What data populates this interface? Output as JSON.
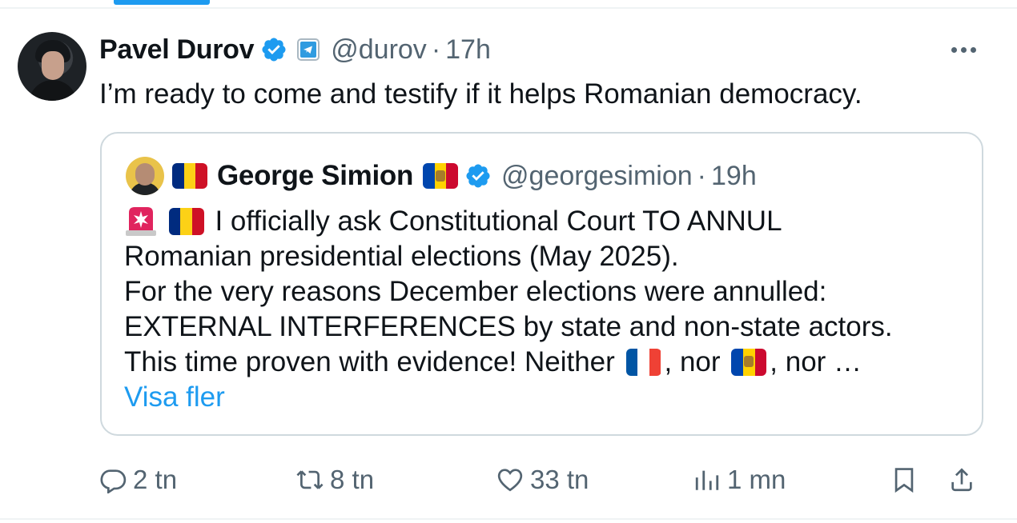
{
  "tweet": {
    "author_name": "Pavel Durov",
    "handle": "@durov",
    "separator": "·",
    "time": "17h",
    "text": "I’m ready to come and testify if it helps Romanian democracy.",
    "icons": {
      "verified": "verified-badge-icon",
      "telegram": "telegram-icon",
      "more": "more-options-icon"
    }
  },
  "quote": {
    "author_name": "George Simion",
    "handle": "@georgesimion",
    "separator": "·",
    "time": "19h",
    "lines": [
      "I officially ask Constitutional Court TO ANNUL",
      "Romanian presidential elections (May 2025).",
      "For the very reasons December elections were annulled:",
      "EXTERNAL INTERFERENCES by state and non-state actors.",
      "This time proven with evidence! Neither",
      ", nor",
      ", nor …"
    ],
    "show_more": "Visa fler",
    "flags": [
      "romania-flag",
      "moldova-flag",
      "france-flag"
    ],
    "colors": {
      "romania": [
        "#002b7f",
        "#fcd116",
        "#ce1126"
      ],
      "moldova": [
        "#0046ae",
        "#ffd200",
        "#cc092f"
      ],
      "france": [
        "#0055a4",
        "#ffffff",
        "#ef4135"
      ]
    }
  },
  "actions": {
    "replies": "2 tn",
    "reposts": "8 tn",
    "likes": "33 tn",
    "views": "1 mn"
  },
  "colors": {
    "accent": "#1d9bf0",
    "muted": "#536471",
    "border": "#cfd9de"
  }
}
